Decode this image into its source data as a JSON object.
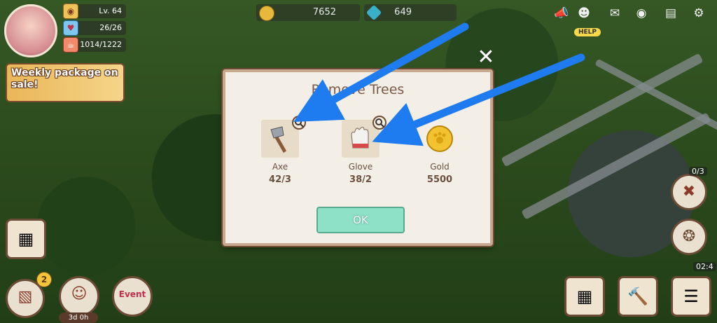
{
  "hud": {
    "level": "Lv. 64",
    "hearts": "26/26",
    "food": "1014/1222",
    "weekly_banner": "Weekly package on sale!",
    "coins": "7652",
    "gems": "649",
    "help_label": "HELP",
    "event_badge_count": "2",
    "event_timer": "3d 0h",
    "event_label": "Event",
    "remove_count": "0/3",
    "side_timer": "02:4"
  },
  "dialog": {
    "title": "Remove Trees",
    "items": [
      {
        "name": "Axe",
        "count": "42/3"
      },
      {
        "name": "Glove",
        "count": "38/2"
      },
      {
        "name": "Gold",
        "count": "5500"
      }
    ],
    "ok_label": "OK",
    "close_label": "✕"
  },
  "colors": {
    "arrow": "#1e7bf0",
    "ok_button": "#8ee0c6",
    "dialog_bg": "#f4efe6"
  },
  "icons": [
    "axe-icon",
    "glove-icon",
    "gold-coin-icon",
    "magnifier-icon",
    "megaphone-icon",
    "cat-icon",
    "mail-icon",
    "camera-icon",
    "chat-icon",
    "settings-icon"
  ]
}
